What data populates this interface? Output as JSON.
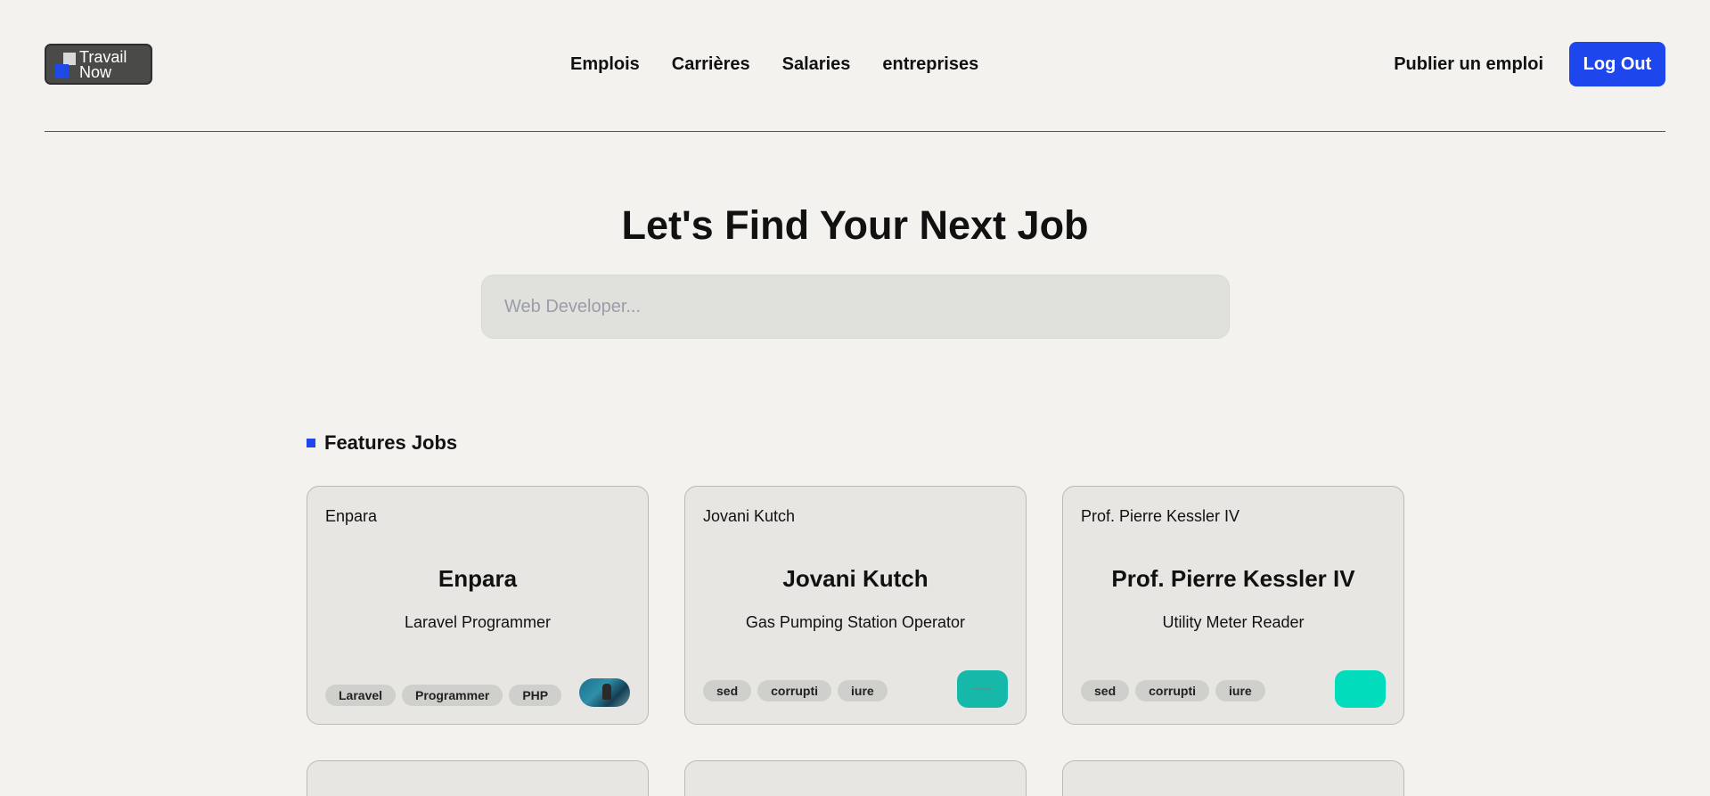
{
  "header": {
    "logo": {
      "line1": "Travail",
      "line2": "Now"
    },
    "nav": [
      "Emplois",
      "Carrières",
      "Salaries",
      "entreprises"
    ],
    "post_job": "Publier un emploi",
    "logout": "Log Out"
  },
  "hero": {
    "title": "Let's Find Your Next Job",
    "search_placeholder": "Web Developer...",
    "search_value": ""
  },
  "featured": {
    "title": "Features Jobs",
    "accent_color": "#1d47ec",
    "cards": [
      {
        "company": "Enpara",
        "title": "Enpara",
        "role": "Laravel Programmer",
        "tags": [
          "Laravel",
          "Programmer",
          "PHP"
        ],
        "thumb": "photo-thumbnail"
      },
      {
        "company": "Jovani Kutch",
        "title": "Jovani Kutch",
        "role": "Gas Pumping Station Operator",
        "tags": [
          "sed",
          "corrupti",
          "iure"
        ],
        "thumb": "teal-thumbnail"
      },
      {
        "company": "Prof. Pierre Kessler IV",
        "title": "Prof. Pierre Kessler IV",
        "role": "Utility Meter Reader",
        "tags": [
          "sed",
          "corrupti",
          "iure"
        ],
        "thumb": "mint-thumbnail"
      }
    ]
  }
}
